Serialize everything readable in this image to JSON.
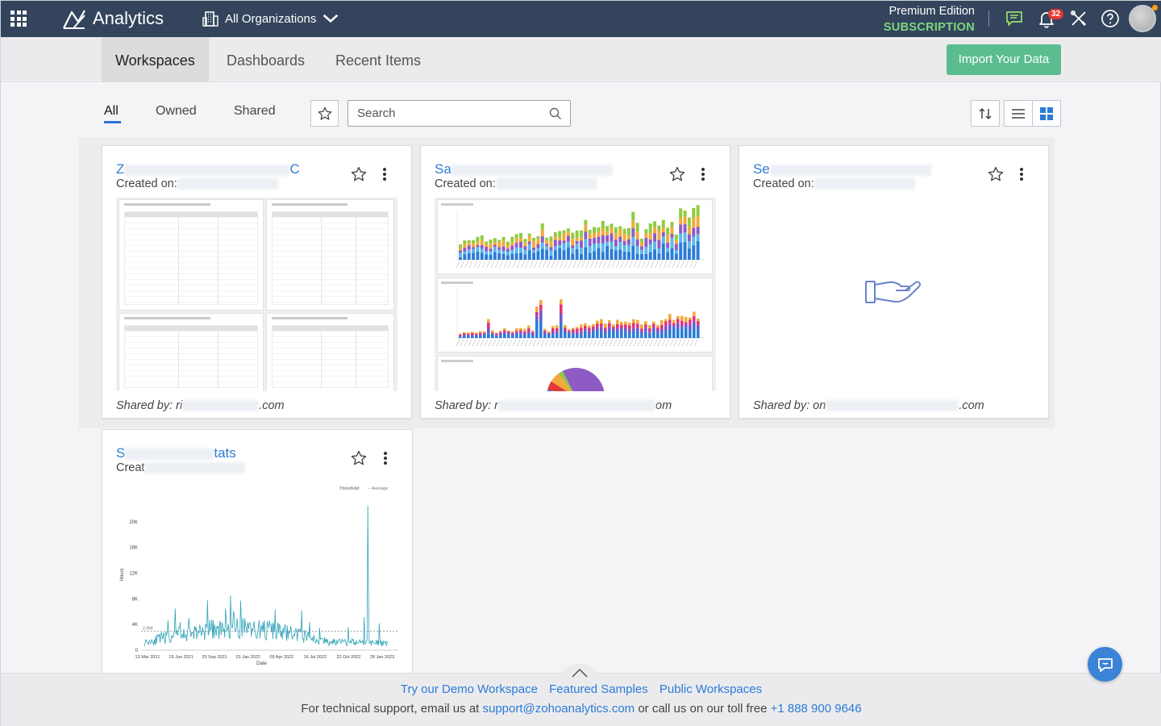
{
  "topbar": {
    "brand": "Analytics",
    "org_selector": "All Organizations",
    "edition": "Premium Edition",
    "subscription": "SUBSCRIPTION",
    "notification_count": "32",
    "background": "#33445c",
    "subscription_color": "#7ed67e"
  },
  "tabs": {
    "workspaces": "Workspaces",
    "dashboards": "Dashboards",
    "recent": "Recent Items",
    "active": "Workspaces"
  },
  "import_button": "Import Your Data",
  "filters": {
    "all": "All",
    "owned": "Owned",
    "shared": "Shared",
    "active": "All"
  },
  "search": {
    "placeholder": "Search",
    "value": ""
  },
  "view": {
    "mode": "grid"
  },
  "cards": [
    {
      "title_prefix": "Z",
      "title_suffix": "C",
      "created_label": "Created on:",
      "shared_prefix": "Shared by: ri",
      "shared_suffix": ".com",
      "preview": "tables"
    },
    {
      "title_prefix": "Sa",
      "title_suffix": "",
      "created_label": "Created on:",
      "shared_prefix": "Shared by: r",
      "shared_suffix": "om",
      "preview": "charts"
    },
    {
      "title_prefix": "Se",
      "title_suffix": "",
      "created_label": "Created on:",
      "shared_prefix": "Shared by: on",
      "shared_suffix": ".com",
      "preview": "empty"
    },
    {
      "title_prefix": "S",
      "title_suffix": "tats",
      "created_label": "Creat",
      "shared_prefix": "",
      "shared_suffix": "",
      "preview": "line-chart"
    }
  ],
  "charts": [
    {
      "type": "bar",
      "title": "",
      "series_colors": [
        "#2b7bd6",
        "#5bb8e8",
        "#8e5bc5",
        "#f2a93b",
        "#8fcb3f"
      ]
    },
    {
      "type": "bar",
      "title": "",
      "series_colors": [
        "#2b7bd6",
        "#6a5acd",
        "#e2337a",
        "#f2a93b"
      ]
    },
    {
      "type": "pie",
      "title": "",
      "series_colors": [
        "#2b7bd6",
        "#e23a3a",
        "#f2a93b",
        "#8fcb3f",
        "#8e5bc5"
      ]
    }
  ],
  "chart_data": {
    "type": "line",
    "title": "",
    "xlabel": "Date",
    "ylabel": "Hours",
    "ylim": [
      0,
      24000
    ],
    "yticks": [
      "0",
      "4K",
      "8K",
      "12K",
      "16K",
      "20K"
    ],
    "xticks": [
      "13 Mar 2021",
      "19 Jun 2021",
      "25 Sep 2021",
      "01 Jan 2022",
      "09 Apr 2022",
      "16 Jul 2022",
      "22 Oct 2022",
      "28 Jan 2023"
    ],
    "legend": [
      "Threshold",
      "Average"
    ],
    "average_label": "2.95K",
    "average": 2950,
    "color": "#2fa3b8"
  },
  "footer": {
    "demo": "Try our Demo Workspace",
    "samples": "Featured Samples",
    "public": "Public Workspaces",
    "support_prefix": "For technical support, email us at",
    "support_email": "support@zohoanalytics.com",
    "support_mid": "or call us on our toll free",
    "support_phone": "+1 888 900 9646"
  }
}
